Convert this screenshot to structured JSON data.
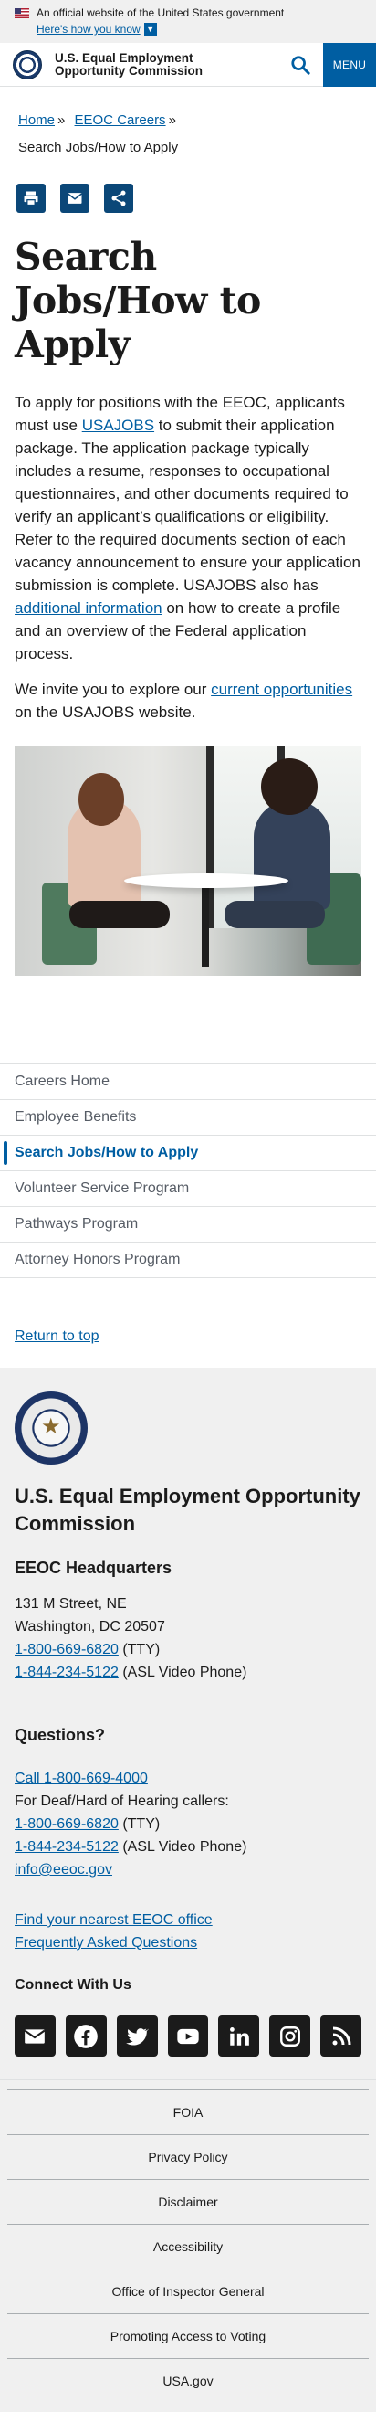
{
  "gov_banner": {
    "text": "An official website of the United States government",
    "link": "Here's how you know"
  },
  "header": {
    "agency_name": "U.S. Equal Employment Opportunity Commission",
    "menu_label": "MENU"
  },
  "breadcrumb": {
    "items": [
      "Home",
      "EEOC Careers"
    ],
    "separator": "»",
    "current": "Search Jobs/How to Apply"
  },
  "share": {
    "icons": [
      "print-icon",
      "email-icon",
      "share-icon"
    ]
  },
  "page": {
    "title": "Search Jobs/How to Apply",
    "p1_a": "To apply for positions with the EEOC, applicants must use ",
    "p1_link1": "USAJOBS",
    "p1_b": " to submit their application package. The application package typically includes a resume, responses to occupational questionnaires, and other documents required to verify an applicant’s qualifications or eligibility. Refer to the required documents section of each vacancy announcement to ensure your application submission is complete. USAJOBS also has ",
    "p1_link2": "additional information",
    "p1_c": " on how to create a profile and an overview of the Federal application process.",
    "p2_a": "We invite you to explore our ",
    "p2_link": "current opportunities",
    "p2_b": " on the USAJOBS website."
  },
  "sidenav": {
    "items": [
      {
        "label": "Careers Home"
      },
      {
        "label": "Employee Benefits"
      },
      {
        "label": "Search Jobs/How to Apply",
        "current": true
      },
      {
        "label": "Volunteer Service Program"
      },
      {
        "label": "Pathways Program"
      },
      {
        "label": "Attorney Honors Program"
      }
    ]
  },
  "return_to_top": "Return to top",
  "footer": {
    "agency_name": "U.S. Equal Employment Opportunity Commission",
    "hq_heading": "EEOC Headquarters",
    "address1": "131 M Street, NE",
    "address2": "Washington, DC 20507",
    "tty_phone": "1-800-669-6820",
    "tty_label": " (TTY)",
    "asl_phone": "1-844-234-5122",
    "asl_label": " (ASL Video Phone)",
    "questions_heading": "Questions?",
    "call_link": "Call 1-800-669-4000",
    "deaf_label": "For Deaf/Hard of Hearing callers:",
    "q_tty_phone": "1-800-669-6820",
    "q_tty_label": " (TTY)",
    "q_asl_phone": "1-844-234-5122",
    "q_asl_label": " (ASL Video Phone)",
    "email": "info@eeoc.gov",
    "office_link": "Find your nearest EEOC office",
    "faq_link": "Frequently Asked Questions",
    "connect_heading": "Connect With Us",
    "social": [
      "email-icon",
      "facebook-icon",
      "twitter-icon",
      "youtube-icon",
      "linkedin-icon",
      "instagram-icon",
      "rss-icon"
    ]
  },
  "footer_links": [
    "FOIA",
    "Privacy Policy",
    "Disclaimer",
    "Accessibility",
    "Office of Inspector General",
    "Promoting Access to Voting",
    "USA.gov"
  ]
}
